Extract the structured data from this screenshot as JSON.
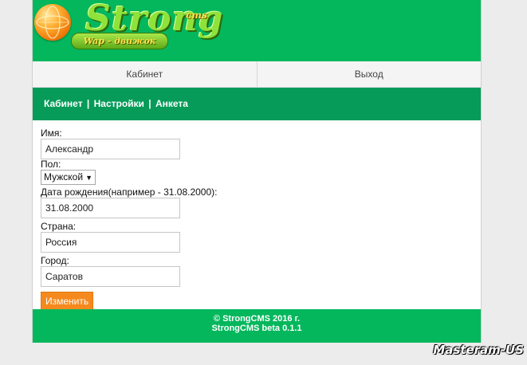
{
  "header": {
    "logo_text": "Strong",
    "logo_suffix": "cms",
    "logo_sub": "Wap - движок"
  },
  "topnav": {
    "cabinet": "Кабинет",
    "exit": "Выход"
  },
  "subnav": {
    "cabinet": "Кабинет",
    "settings": "Настройки",
    "profile": "Анкета",
    "separator": "|"
  },
  "form": {
    "name_label": "Имя:",
    "name_value": "Александр",
    "gender_label": "Пол:",
    "gender_value": "Мужской",
    "birth_label": "Дата рождения(например - 31.08.2000):",
    "birth_value": "31.08.2000",
    "country_label": "Страна:",
    "country_value": "Россия",
    "city_label": "Город:",
    "city_value": "Саратов",
    "submit_label": "Изменить"
  },
  "footer": {
    "copyright": "© StrongCMS 2016 г.",
    "version": "StrongCMS beta 0.1.1"
  },
  "watermark": "Masteram-US",
  "colors": {
    "brand_green": "#04b75c",
    "subnav_green": "#069b58",
    "button_orange": "#f5891e"
  }
}
